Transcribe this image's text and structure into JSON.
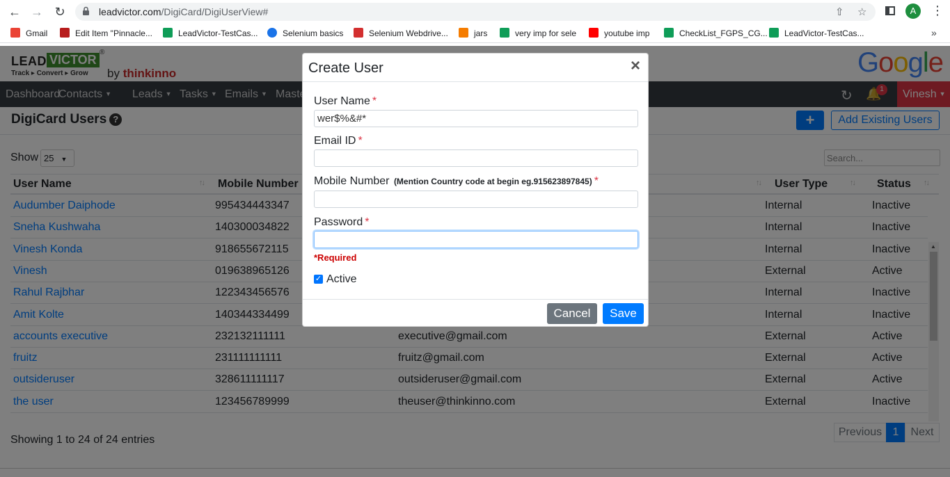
{
  "browser": {
    "url_domain": "leadvictor.com",
    "url_path": "/DigiCard/DigiUserView#",
    "profile_initial": "A",
    "bookmarks": [
      {
        "label": "Gmail",
        "color": "#ea4335"
      },
      {
        "label": "Edit Item \"Pinnacle...",
        "color": "#b71c1c"
      },
      {
        "label": "LeadVictor-TestCas...",
        "color": "#0f9d58"
      },
      {
        "label": "Selenium basics",
        "color": "#1a73e8"
      },
      {
        "label": "Selenium Webdrive...",
        "color": "#d32f2f"
      },
      {
        "label": "jars",
        "color": "#f57c00"
      },
      {
        "label": "very imp for sele",
        "color": "#0f9d58"
      },
      {
        "label": "youtube imp",
        "color": "#ff0000"
      },
      {
        "label": "CheckList_FGPS_CG...",
        "color": "#0f9d58"
      },
      {
        "label": "LeadVictor-TestCas...",
        "color": "#0f9d58"
      }
    ],
    "more_label": "»"
  },
  "brand": {
    "lead": "LEAD",
    "victor": "VICTOR",
    "reg": "®",
    "tagline": "Track ▸ Convert ▸ Grow",
    "by": "by",
    "thinkinno": "thinkinno",
    "google": [
      "G",
      "o",
      "o",
      "g",
      "l",
      "e"
    ],
    "google_colors": [
      "#4285f4",
      "#ea4335",
      "#fbbc05",
      "#4285f4",
      "#34a853",
      "#ea4335"
    ]
  },
  "nav": {
    "items": [
      "Dashboard",
      "Contacts",
      "Leads",
      "Tasks",
      "Emails",
      "Maste"
    ],
    "badge": "1",
    "user": "Vinesh"
  },
  "page": {
    "title": "DigiCard Users",
    "help": "?",
    "plus": "+",
    "add_existing": "Add Existing Users",
    "show_label": "Show",
    "show_value": "25",
    "search_placeholder": "Search...",
    "columns": [
      "User Name",
      "Mobile Number",
      "User Type",
      "Status"
    ],
    "rows": [
      {
        "name": "Audumber Daiphode",
        "mobile": "995434443347",
        "email": "",
        "type": "Internal",
        "status": "Inactive"
      },
      {
        "name": "Sneha Kushwaha",
        "mobile": "140300034822",
        "email": "",
        "type": "Internal",
        "status": "Inactive"
      },
      {
        "name": "Vinesh Konda",
        "mobile": "918655672115",
        "email": "",
        "type": "Internal",
        "status": "Inactive"
      },
      {
        "name": "Vinesh",
        "mobile": "019638965126",
        "email": "",
        "type": "External",
        "status": "Active"
      },
      {
        "name": "Rahul Rajbhar",
        "mobile": "122343456576",
        "email": "",
        "type": "Internal",
        "status": "Inactive"
      },
      {
        "name": "Amit Kolte",
        "mobile": "140344334499",
        "email": "",
        "type": "Internal",
        "status": "Inactive"
      },
      {
        "name": "accounts executive",
        "mobile": "232132111111",
        "email": "executive@gmail.com",
        "type": "External",
        "status": "Active"
      },
      {
        "name": "fruitz",
        "mobile": "231111111111",
        "email": "fruitz@gmail.com",
        "type": "External",
        "status": "Active"
      },
      {
        "name": "outsideruser",
        "mobile": "328611111117",
        "email": "outsideruser@gmail.com",
        "type": "External",
        "status": "Active"
      },
      {
        "name": "the user",
        "mobile": "123456789999",
        "email": "theuser@thinkinno.com",
        "type": "External",
        "status": "Inactive"
      }
    ],
    "showing": "Showing 1 to 24 of 24 entries",
    "pagination": {
      "previous": "Previous",
      "current": "1",
      "next": "Next"
    }
  },
  "modal": {
    "title": "Create User",
    "close": "×",
    "username_label": "User Name",
    "username_value": "wer$%&#*",
    "email_label": "Email ID",
    "email_value": "",
    "mobile_label": "Mobile Number",
    "mobile_hint": "(Mention Country code at begin eg.915623897845)",
    "mobile_value": "",
    "password_label": "Password",
    "password_value": "",
    "required_star": "*",
    "required_msg": "*Required",
    "active_label": "Active",
    "active_checked": true,
    "cancel": "Cancel",
    "save": "Save"
  }
}
